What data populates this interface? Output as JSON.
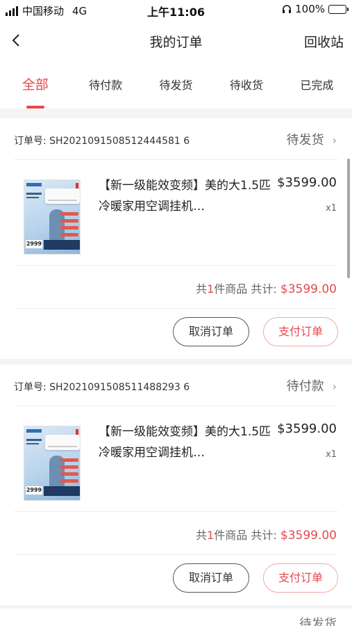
{
  "status_bar": {
    "carrier": "中国移动",
    "network": "4G",
    "time": "上午11:06",
    "battery": "100%",
    "battery_level": 1.0
  },
  "nav": {
    "back_icon": "chevron-left-icon",
    "title": "我的订单",
    "right_link": "回收站"
  },
  "tabs": [
    {
      "label": "全部",
      "active": true
    },
    {
      "label": "待付款",
      "active": false
    },
    {
      "label": "待发货",
      "active": false
    },
    {
      "label": "待收货",
      "active": false
    },
    {
      "label": "已完成",
      "active": false
    }
  ],
  "orders": [
    {
      "order_no": "订单号: SH2021091508512444581 6",
      "status": "待发货",
      "product_name": "【新一级能效变频】美的大1.5匹冷暖家用空调挂机…",
      "price": "$3599.00",
      "qty": "x1",
      "summary_prefix": "共",
      "summary_count": "1",
      "summary_middle": "件商品  共计: ",
      "total": "$3599.00",
      "thumb_price": "2999",
      "cancel_label": "取消订单",
      "pay_label": "支付订单"
    },
    {
      "order_no": "订单号: SH2021091508511488293 6",
      "status": "待付款",
      "product_name": "【新一级能效变频】美的大1.5匹冷暖家用空调挂机…",
      "price": "$3599.00",
      "qty": "x1",
      "summary_prefix": "共",
      "summary_count": "1",
      "summary_middle": "件商品  共计: ",
      "total": "$3599.00",
      "thumb_price": "2999",
      "cancel_label": "取消订单",
      "pay_label": "支付订单"
    }
  ],
  "next_order_status": "待发货",
  "colors": {
    "accent": "#e5484d",
    "background": "#f4f4f4",
    "battery": "#3ec33e"
  }
}
